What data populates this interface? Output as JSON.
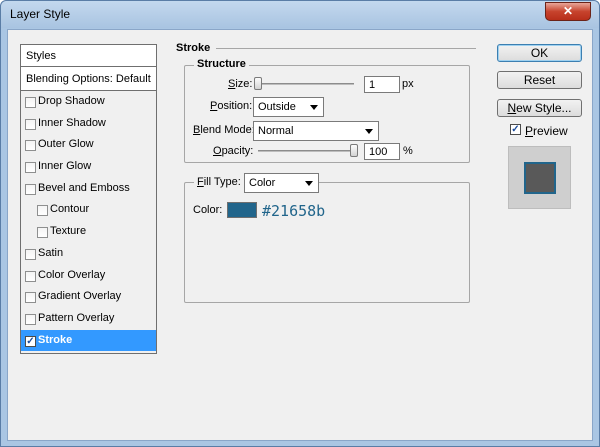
{
  "window": {
    "title": "Layer Style",
    "close_glyph": "✕"
  },
  "styles_panel": {
    "header": "Styles",
    "blending": "Blending Options: Default",
    "items": [
      {
        "label": "Drop Shadow",
        "checked": false,
        "indent": false
      },
      {
        "label": "Inner Shadow",
        "checked": false,
        "indent": false
      },
      {
        "label": "Outer Glow",
        "checked": false,
        "indent": false
      },
      {
        "label": "Inner Glow",
        "checked": false,
        "indent": false
      },
      {
        "label": "Bevel and Emboss",
        "checked": false,
        "indent": false
      },
      {
        "label": "Contour",
        "checked": false,
        "indent": true
      },
      {
        "label": "Texture",
        "checked": false,
        "indent": true
      },
      {
        "label": "Satin",
        "checked": false,
        "indent": false
      },
      {
        "label": "Color Overlay",
        "checked": false,
        "indent": false
      },
      {
        "label": "Gradient Overlay",
        "checked": false,
        "indent": false
      },
      {
        "label": "Pattern Overlay",
        "checked": false,
        "indent": false
      },
      {
        "label": "Stroke",
        "checked": true,
        "indent": false,
        "selected": true
      }
    ]
  },
  "stroke": {
    "title": "Stroke",
    "structure_title": "Structure",
    "size_label_u": "S",
    "size_label_rest": "ize:",
    "size_value": "1",
    "size_unit": "px",
    "size_level": 0.0,
    "position_label_u": "P",
    "position_label_rest": "osition:",
    "position_value": "Outside",
    "blend_label_u": "B",
    "blend_label_rest": "lend Mode:",
    "blend_value": "Normal",
    "opacity_label_u": "O",
    "opacity_label_rest": "pacity:",
    "opacity_value": "100",
    "opacity_unit": "%",
    "opacity_level": 1.0,
    "fill_type_label_u": "F",
    "fill_type_label_rest": "ill Type:",
    "fill_type_value": "Color",
    "color_label": "Color:",
    "color_hex": "#21658b",
    "swatch_color": "#21658b"
  },
  "buttons": {
    "ok": "OK",
    "reset": "Reset",
    "new_style_u": "N",
    "new_style_rest": "ew Style...",
    "preview_u": "P",
    "preview_rest": "review",
    "preview_checked": true
  }
}
